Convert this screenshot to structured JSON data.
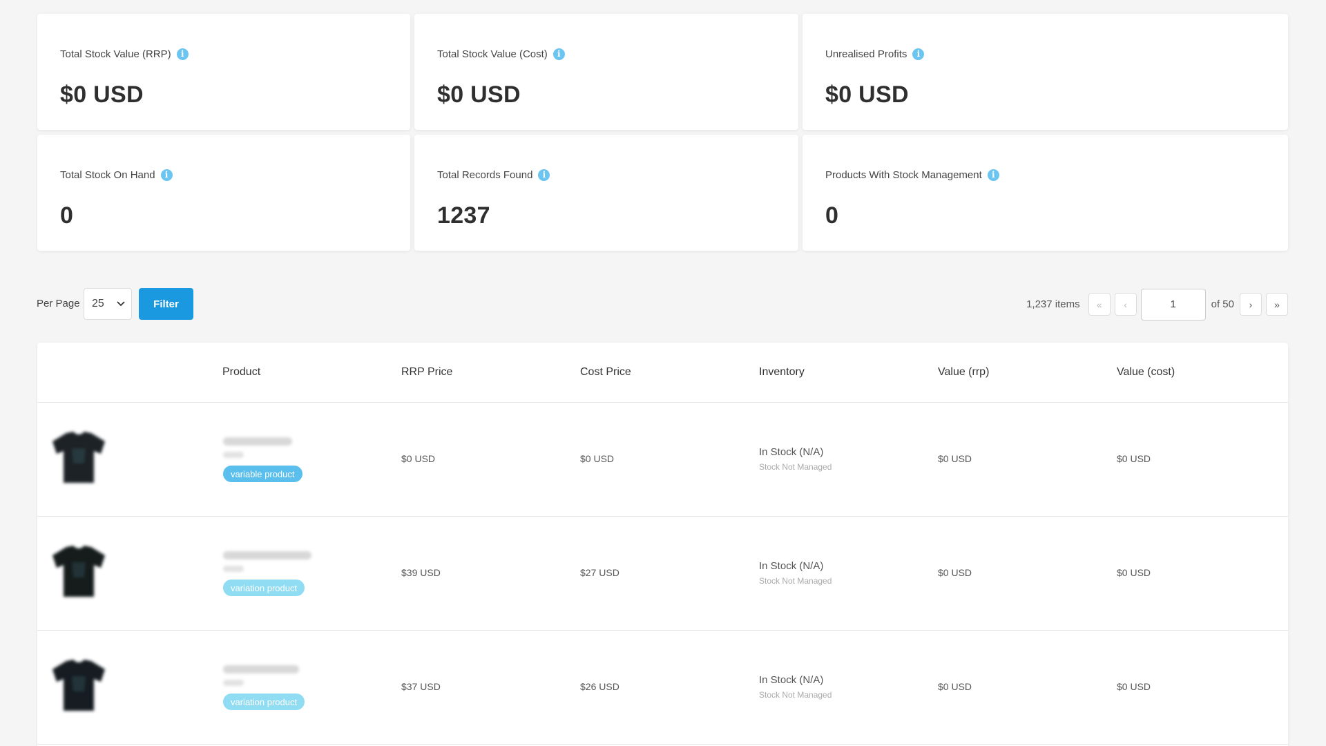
{
  "cards": [
    {
      "label": "Total Stock Value (RRP)",
      "value": "$0 USD"
    },
    {
      "label": "Total Stock Value (Cost)",
      "value": "$0 USD"
    },
    {
      "label": "Unrealised Profits",
      "value": "$0 USD"
    },
    {
      "label": "Total Stock On Hand",
      "value": "0"
    },
    {
      "label": "Total Records Found",
      "value": "1237"
    },
    {
      "label": "Products With Stock Management",
      "value": "0"
    }
  ],
  "info_icon": "info-icon",
  "toolbar": {
    "per_page_label": "Per Page",
    "per_page_value": "25",
    "filter_label": "Filter"
  },
  "pager": {
    "items": "1,237 items",
    "first": "«",
    "prev": "‹",
    "page": "1",
    "of": "of 50",
    "next": "›",
    "last": "»"
  },
  "table": {
    "headers": {
      "product": "Product",
      "rrp": "RRP Price",
      "cost": "Cost Price",
      "inventory": "Inventory",
      "value_rrp": "Value (rrp)",
      "value_cost": "Value (cost)"
    },
    "rows": [
      {
        "badge": "variable product",
        "rrp": "$0 USD",
        "cost": "$0 USD",
        "inventory": "In Stock (N/A)",
        "stock_note": "Stock Not Managed",
        "value_rrp": "$0 USD",
        "value_cost": "$0 USD"
      },
      {
        "badge": "variation product",
        "rrp": "$39 USD",
        "cost": "$27 USD",
        "inventory": "In Stock (N/A)",
        "stock_note": "Stock Not Managed",
        "value_rrp": "$0 USD",
        "value_cost": "$0 USD"
      },
      {
        "badge": "variation product",
        "rrp": "$37 USD",
        "cost": "$26 USD",
        "inventory": "In Stock (N/A)",
        "stock_note": "Stock Not Managed",
        "value_rrp": "$0 USD",
        "value_cost": "$0 USD"
      }
    ]
  },
  "colors": {
    "accent": "#1a98e0",
    "info": "#6cc4f0",
    "variable_badge": "#5bbfee",
    "variation_badge": "#8fdcf3"
  }
}
